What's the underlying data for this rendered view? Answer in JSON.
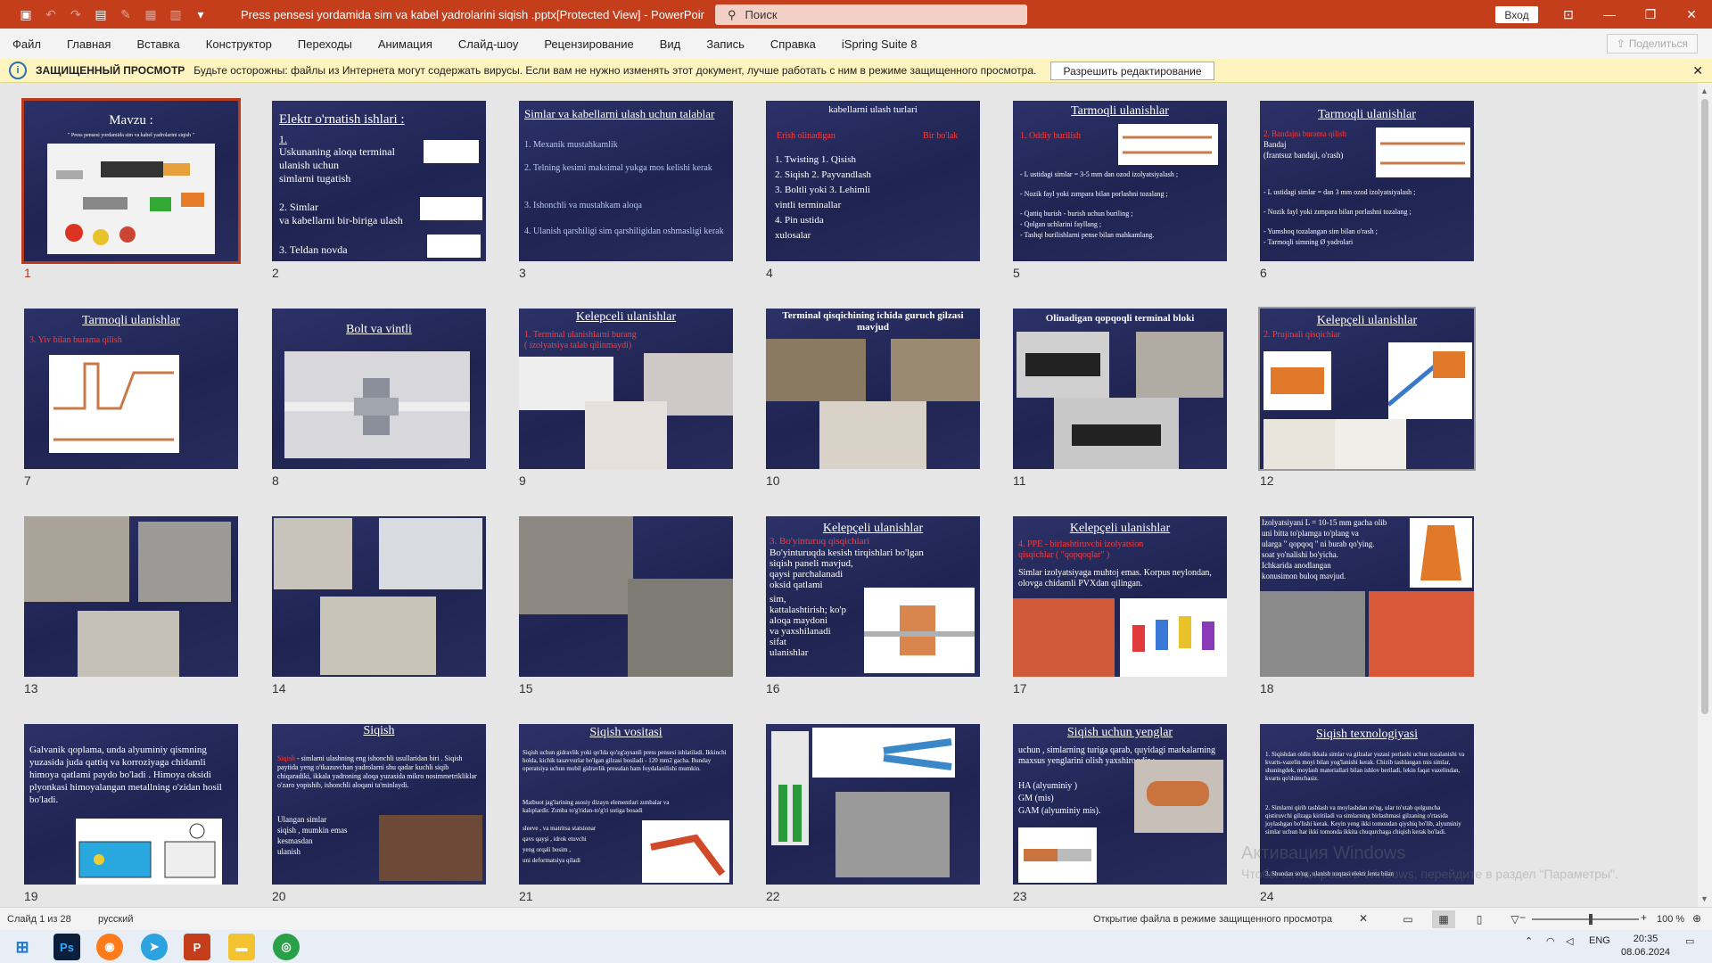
{
  "window": {
    "title": "Press pensesi yordamida sim va kabel yadrolarini siqish .pptx[Protected View]  -  PowerPoint",
    "search_placeholder": "Поиск",
    "signin": "Вход"
  },
  "ribbon": {
    "tabs": [
      "Файл",
      "Главная",
      "Вставка",
      "Конструктор",
      "Переходы",
      "Анимация",
      "Слайд-шоу",
      "Рецензирование",
      "Вид",
      "Запись",
      "Справка",
      "iSpring Suite 8"
    ],
    "share": "Поделиться"
  },
  "protected": {
    "title": "ЗАЩИЩЕННЫЙ ПРОСМОТР",
    "message": "Будьте осторожны: файлы из Интернета могут содержать вирусы. Если вам не нужно изменять этот документ, лучше работать с ним в режиме защищенного просмотра.",
    "enable_button": "Разрешить редактирование"
  },
  "slides": {
    "s1": {
      "num": "1",
      "title": "Mavzu :",
      "subtitle": "\" Press pensesi yordamida sim va kabel yadrolarini siqish \""
    },
    "s2": {
      "num": "2",
      "title": "Elektr o'rnatish ishlari :",
      "l1": "1.",
      "l2": "Uskunaning aloqa terminal",
      "l3": "ulanish uchun",
      "l4": "simlarni tugatish",
      "l5": "2. Simlar",
      "l6": "va kabellarni bir-biriga ulash",
      "l7": "3. Teldan novda"
    },
    "s3": {
      "num": "3",
      "title": "Simlar va kabellarni ulash uchun talablar",
      "l1": "1. Mexanik mustahkamlik",
      "l2": "2. Telning kesimi maksimal yukga mos kelishi kerak",
      "l3": "3. Ishonchli va mustahkam aloqa",
      "l4": "4. Ulanish qarshiligi sim qarshiligidan oshmasligi kerak"
    },
    "s4": {
      "num": "4",
      "title": "kabellarni ulash turlari",
      "red1": "Erish olinadigan",
      "red2": "Bir bo'lak",
      "l1": "1. Twisting 1. Qisish",
      "l2": "2. Siqish 2. Payvandlash",
      "l3": "3. Boltli yoki 3. Lehimli",
      "l4": "vintli terminallar",
      "l5": "4. Pin ustida",
      "l6": "xulosalar"
    },
    "s5": {
      "num": "5",
      "title": "Tarmoqli ulanishlar",
      "red": "1. Oddiy burilish",
      "l1": "- L ustidagi simlar = 3-5 mm dan ozod izolyatsiyalash ;",
      "l2": "- Nozik fayl yoki zımpara bilan porlashni tozalang ;",
      "l3": "- Qattiq burish - burish uchun buriling ;",
      "l4": "- Qolgan uchlarini fayllang ;",
      "l5": "- Tashqi burilishlarni pense bilan mahkamlang."
    },
    "s6": {
      "num": "6",
      "title": "Tarmoqli ulanishlar",
      "red": "2. Bandajni burama qilish",
      "l0": "Bandaj",
      "l00": "(frantsuz bandaji, o'rash)",
      "l1": "- L ustidagi simlar = dan 3 mm ozod izolyatsiyalash ;",
      "l2": "- Nozik fayl yoki zımpara bilan porlashni tozalang ;",
      "l3": "- Yumshoq tozalangan sim bilan o'rash ;",
      "l4": "- Tarmoqli simning Ø yadrolari"
    },
    "s7": {
      "num": "7",
      "title": "Tarmoqli ulanishlar",
      "red": "3. Yiv bilan burama qilish"
    },
    "s8": {
      "num": "8",
      "title": "Bolt va vintli"
    },
    "s9": {
      "num": "9",
      "title": "Kelepceli ulanishlar",
      "red1": "1. Terminal ulanishlarni burang",
      "red2": "( izolyatsiya talab qilinmaydi)"
    },
    "s10": {
      "num": "10",
      "title": "Terminal qisqichining ichida guruch gilzasi mavjud"
    },
    "s11": {
      "num": "11",
      "title": "Olinadigan qopqoqli terminal bloki"
    },
    "s12": {
      "num": "12",
      "title": "Kelepçeli ulanishlar",
      "red": "2. Prujinali qisqichlar"
    },
    "s13": {
      "num": "13"
    },
    "s14": {
      "num": "14"
    },
    "s15": {
      "num": "15"
    },
    "s16": {
      "num": "16",
      "title": "Kelepçeli ulanishlar",
      "red": "3. Bo'yinturuq qisqichlari",
      "l1": "Bo'yinturuqda kesish tirqishlari bo'lgan",
      "l2": "siqish paneli mavjud,",
      "l3": "qaysi parchalanadi",
      "l4": "oksid qatlami",
      "l5": "sim,",
      "l6": "kattalashtirish; ko'p",
      "l7": "aloqa maydoni",
      "l8": "va yaxshilanadi",
      "l9": "sifat",
      "l10": "ulanishlar"
    },
    "s17": {
      "num": "17",
      "title": "Kelepçeli ulanishlar",
      "red1": "4. PPE - birlashtiruvchi izolyatsion",
      "red2": "qisqichlar ( \"qopqoqlar\" )",
      "l1": "Simlar izolyatsiyaga muhtoj emas. Korpus neylondan, olovga chidamli PVXdan qilingan."
    },
    "s18": {
      "num": "18",
      "l1": "Izolyatsiyani L = 10-15 mm gacha olib",
      "l2": "uni bitta to'plamga to'plang va",
      "l3": "ularga \" qopqoq \" ni burab qo'ying.",
      "l4": "soat yo'nalishi bo'yicha.",
      "l5": "Ichkarida anodlangan",
      "l6": "konusimon buloq mavjud."
    },
    "s19": {
      "num": "19",
      "l1": "Galvanik qoplama, unda alyuminiy qismning yuzasida juda qattiq va korroziyaga chidamli himoya qatlami paydo bo'ladi . Himoya oksidi plyonkasi himoyalangan metallning o'zidan hosil bo'ladi."
    },
    "s20": {
      "num": "20",
      "title": "Siqish",
      "red": "Siqish",
      "l1": " - simlarni ulashning eng ishonchli usullaridan biri . Siqish paytida yeng o'tkazuvchan yadrolarni shu qadar kuchli siqib chiqaradiki, ikkala yadroning aloqa yuzasida mikro nosimmetrikliklar o'zaro yopishib, ishonchli aloqani ta'minlaydi.",
      "l2": "Ulangan simlar",
      "l3": "siqish , mumkin emas",
      "l4": "kesmasdan",
      "l5": "ulanish"
    },
    "s21": {
      "num": "21",
      "title": "Siqish vositasi",
      "l1": "Siqish uchun gidravlik yoki qo'lda qo'zg'aysanli press pensesi ishlatiladi. Ikkinchi holda, kichik tasavvurlar bo'lgan gilzasi bosiladi - 120 mm2 gacha. Bunday operatsiya uchun mobil gidravlik pressdan ham foydalanilishi mumkin.",
      "l2": "Matbuot jag'larining asosiy dizayn elementlari zımbalar va kalıplardir. Zımba to'g'ridan-to'g'ri ustiga bosadi",
      "l3": "sleeve , va matritsa statsionar",
      "l4": "qavs qayşi , idrok etuvchi",
      "l5": "yeng orqali bosim ,",
      "l6": "uni deformatsiya qiladi"
    },
    "s22": {
      "num": "22"
    },
    "s23": {
      "num": "23",
      "title": "Siqish uchun yenglar",
      "l1": "uchun , simlarning turiga qarab, quyidagi markalarning maxsus yenglarini olish yaxshiroqdir :",
      "l2": "HA (alyuminiy )",
      "l3": "GM (mis)",
      "l4": "GAM (alyuminiy mis)."
    },
    "s24": {
      "num": "24",
      "title": "Siqish texnologiyasi",
      "l1": "1. Siqishdan oldin ikkala simlar va gilzalar yuzasi porlashi uchun tozalanishi va kvarts-vazelin moyi bilan yog'lanishi kerak. Chizib tashlangan mis simlar, shuningdek, moylash materiallari bilan ishlov beriladi, lekin faqat vazelindan, kvarts qo'shimchasiz.",
      "l2": "2. Simlarni qirib tashlash va moylashdan so'ng, ular to'xtab qolguncha qistiruvchi gilzaga kiritiladi va simlarning birlashmasi gilzaning o'rtasida joylashgan bo'lishi kerak. Keyin yeng ikki tomondan qiyshiq bo'lib, alyuminiy simlar uchun har ikki tomonda ikkita chuqurchaga chiqish kerak bo'ladi.",
      "l3": "3. Shundan so'ng , ulanish nuqtasi elektr lenta bilan"
    }
  },
  "watermark": {
    "line1": "Активация Windows",
    "line2": "Чтобы активировать Windows, перейдите в раздел \"Параметры\"."
  },
  "status": {
    "slide_info": "Слайд 1 из 28",
    "language": "русский",
    "open_msg": "Открытие файла в режиме защищенного просмотра",
    "zoom": "100 %"
  },
  "taskbar": {
    "lang": "ENG",
    "time": "20:35",
    "date": "08.06.2024"
  },
  "colors": {
    "accent": "#c43e1c",
    "slide_bg": "#242a5a",
    "highlight_red": "#ff3b3b"
  }
}
